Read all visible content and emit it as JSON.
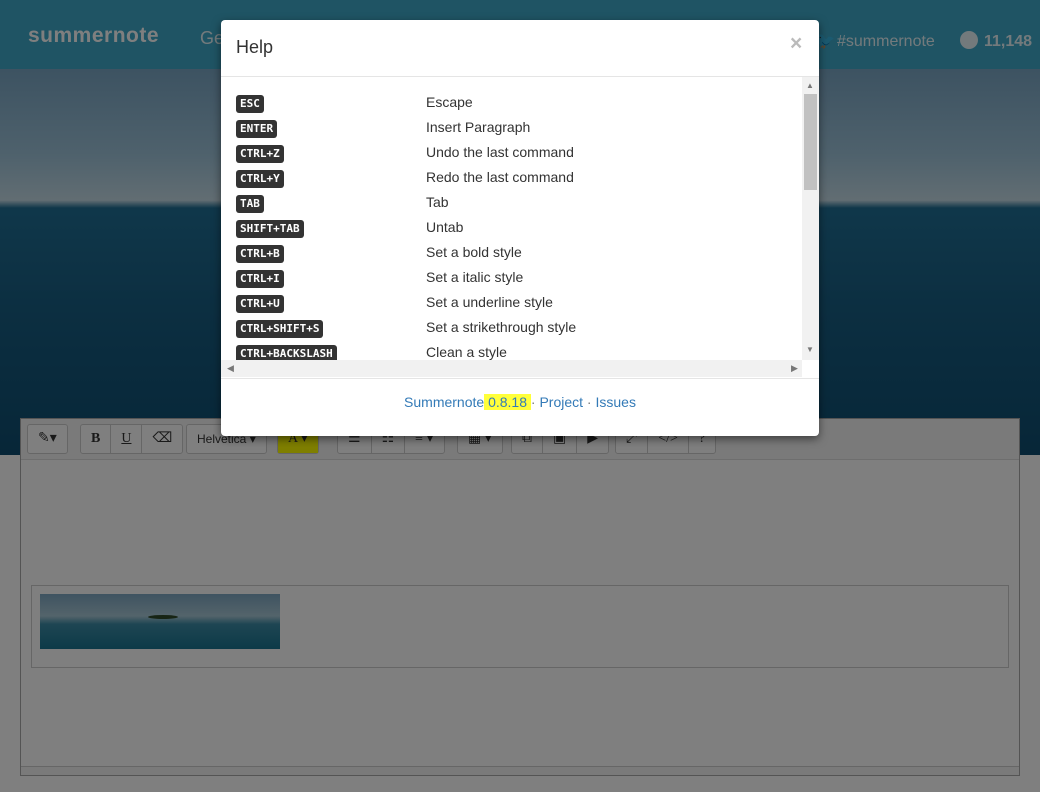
{
  "nav": {
    "brand": "summernote",
    "get_started": "Ge",
    "twitter": "#summernote",
    "github_count": "11,148"
  },
  "toolbar": {
    "style_btn": "✎▾",
    "bold": "B",
    "underline": "U",
    "eraser": "⌫",
    "font_name": "Helvetica ▾",
    "color": "A ▾",
    "ul": "☰",
    "ol": "☷",
    "align": "≡ ▾",
    "table": "▦ ▾",
    "link": "⧉",
    "picture": "▣",
    "video": "▶",
    "fullscreen": "⤢",
    "codeview": "</>",
    "help": "?"
  },
  "modal": {
    "title": "Help",
    "close": "×",
    "shortcuts": [
      {
        "key": "ESC",
        "desc": "Escape"
      },
      {
        "key": "ENTER",
        "desc": "Insert Paragraph"
      },
      {
        "key": "CTRL+Z",
        "desc": "Undo the last command"
      },
      {
        "key": "CTRL+Y",
        "desc": "Redo the last command"
      },
      {
        "key": "TAB",
        "desc": "Tab"
      },
      {
        "key": "SHIFT+TAB",
        "desc": "Untab"
      },
      {
        "key": "CTRL+B",
        "desc": "Set a bold style"
      },
      {
        "key": "CTRL+I",
        "desc": "Set a italic style"
      },
      {
        "key": "CTRL+U",
        "desc": "Set a underline style"
      },
      {
        "key": "CTRL+SHIFT+S",
        "desc": "Set a strikethrough style"
      },
      {
        "key": "CTRL+BACKSLASH",
        "desc": "Clean a style"
      }
    ],
    "footer": {
      "name": "Summernote",
      "version": " 0.8.18 ",
      "sep": "·",
      "project": "Project",
      "issues": "Issues"
    }
  },
  "colors": {
    "nav_bg": "#3fa9c9",
    "link": "#337ab7",
    "highlight": "#ffff3a",
    "kbd_bg": "#333333"
  }
}
